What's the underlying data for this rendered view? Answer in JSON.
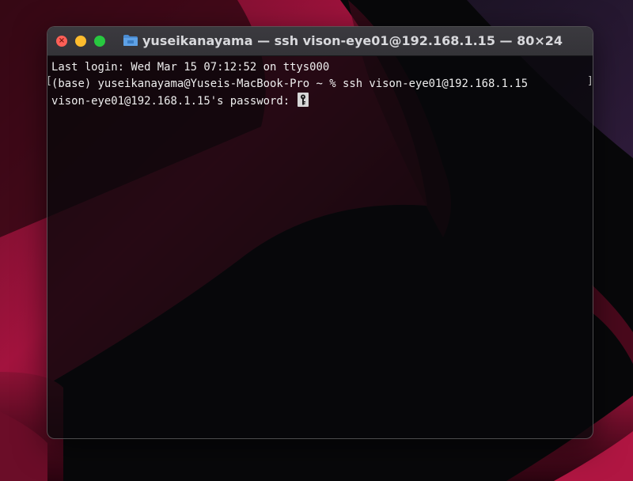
{
  "window": {
    "title": "yuseikanayama — ssh vison-eye01@192.168.1.15 — 80×24"
  },
  "terminal": {
    "lines": [
      "Last login: Wed Mar 15 07:12:52 on ttys000",
      "(base) yuseikanayama@Yuseis-MacBook-Pro ~ % ssh vison-eye01@192.168.1.15",
      "vison-eye01@192.168.1.15's password: "
    ],
    "mark_left": "[",
    "mark_right": "]",
    "cursor_icon": "key-icon"
  },
  "colors": {
    "close": "#fe5f57",
    "minimize": "#febc2e",
    "zoom": "#28c840",
    "text": "#eeeeee"
  }
}
